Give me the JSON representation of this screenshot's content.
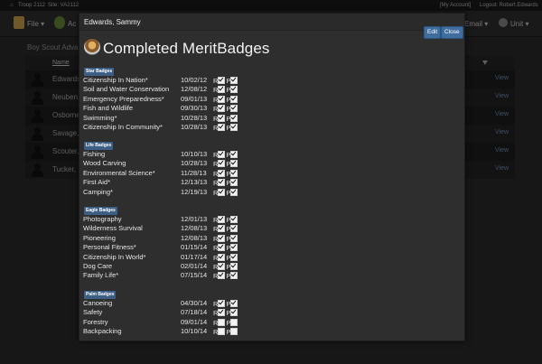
{
  "topbar": {
    "home_icon": "home-icon",
    "troop": "Troop 2112",
    "site": "Site: VA2112",
    "account": "[My Account]",
    "logout": "Logout: Robert.Edwards"
  },
  "nav": {
    "file": "File ▾",
    "activities": "Ac",
    "email": "Email ▾",
    "unit": "Unit ▾"
  },
  "background": {
    "title": "Boy Scout Advanc",
    "column_name": "Name",
    "view_label": "View",
    "rows": [
      "Edwards",
      "Neuben,",
      "Osborne",
      "Savage,",
      "Scouter,",
      "Tucker,"
    ]
  },
  "modal": {
    "scout_name": "Edwards, Sammy",
    "edit_label": "Edit",
    "close_label": "Close",
    "title": "Completed MeritBadges",
    "letter_r": "R",
    "letter_p": "P",
    "sections": [
      {
        "label": "Star Badges",
        "badges": [
          {
            "name": "Citizenship In Nation*",
            "date": "10/02/12",
            "r": true,
            "p": true
          },
          {
            "name": "Soil and Water Conservation",
            "date": "12/08/12",
            "r": true,
            "p": true
          },
          {
            "name": "Emergency Preparedness*",
            "date": "09/01/13",
            "r": true,
            "p": true
          },
          {
            "name": "Fish and Wildlife",
            "date": "09/30/13",
            "r": true,
            "p": true
          },
          {
            "name": "Swimming*",
            "date": "10/28/13",
            "r": true,
            "p": true
          },
          {
            "name": "Citizenship In Community*",
            "date": "10/28/13",
            "r": true,
            "p": true
          }
        ]
      },
      {
        "label": "Life Badges",
        "badges": [
          {
            "name": "Fishing",
            "date": "10/10/13",
            "r": true,
            "p": true
          },
          {
            "name": "Wood Carving",
            "date": "10/28/13",
            "r": true,
            "p": true
          },
          {
            "name": "Environmental Science*",
            "date": "11/28/13",
            "r": true,
            "p": true
          },
          {
            "name": "First Aid*",
            "date": "12/13/13",
            "r": true,
            "p": true
          },
          {
            "name": "Camping*",
            "date": "12/19/13",
            "r": true,
            "p": true
          }
        ]
      },
      {
        "label": "Eagle Badges",
        "badges": [
          {
            "name": "Photography",
            "date": "12/01/13",
            "r": true,
            "p": true
          },
          {
            "name": "Wilderness Survival",
            "date": "12/08/13",
            "r": true,
            "p": true
          },
          {
            "name": "Pioneering",
            "date": "12/08/13",
            "r": true,
            "p": true
          },
          {
            "name": "Personal Fitness*",
            "date": "01/15/14",
            "r": true,
            "p": true
          },
          {
            "name": "Citizenship In World*",
            "date": "01/17/14",
            "r": true,
            "p": true
          },
          {
            "name": "Dog Care",
            "date": "02/01/14",
            "r": true,
            "p": true
          },
          {
            "name": "Family Life*",
            "date": "07/15/14",
            "r": true,
            "p": true
          }
        ]
      },
      {
        "label": "Palm Badges",
        "badges": [
          {
            "name": "Canoeing",
            "date": "04/30/14",
            "r": true,
            "p": true
          },
          {
            "name": "Safety",
            "date": "07/18/14",
            "r": true,
            "p": true
          },
          {
            "name": "Forestry",
            "date": "09/01/14",
            "r": false,
            "p": false
          },
          {
            "name": "Backpacking",
            "date": "10/10/14",
            "r": false,
            "p": false
          }
        ]
      }
    ]
  },
  "colors": {
    "label_bg": "#3d5f86",
    "button_bg": "#3f6e9e",
    "link": "#6f8fb8"
  }
}
